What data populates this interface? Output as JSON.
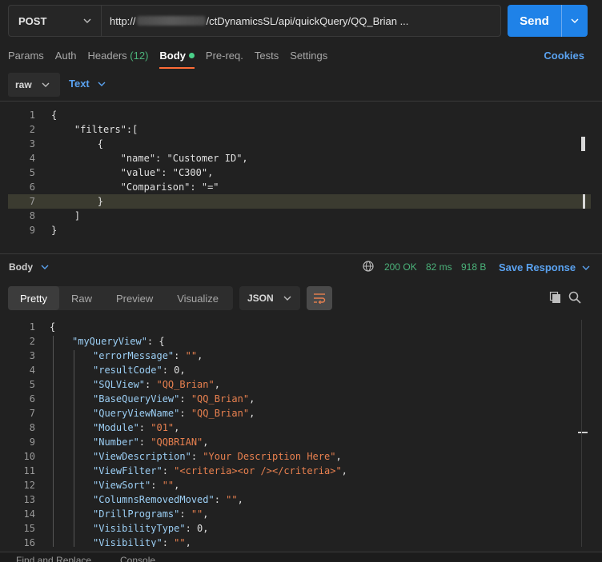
{
  "request": {
    "method": "POST",
    "url_prefix": "http://",
    "url_suffix": "/ctDynamicsSL/api/quickQuery/QQ_Brian ...",
    "send_label": "Send"
  },
  "tabs": [
    {
      "label": "Params"
    },
    {
      "label": "Auth"
    },
    {
      "label": "Headers ",
      "count": "(12)"
    },
    {
      "label": "Body"
    },
    {
      "label": "Pre-req."
    },
    {
      "label": "Tests"
    },
    {
      "label": "Settings"
    }
  ],
  "cookies_label": "Cookies",
  "body_mode": "raw",
  "body_format": "Text",
  "request_body_lines": [
    {
      "n": "1",
      "t": "{"
    },
    {
      "n": "2",
      "t": "    \"filters\":["
    },
    {
      "n": "3",
      "t": "        {"
    },
    {
      "n": "4",
      "t": "            \"name\": \"Customer ID\","
    },
    {
      "n": "5",
      "t": "            \"value\": \"C300\","
    },
    {
      "n": "6",
      "t": "            \"Comparison\": \"=\""
    },
    {
      "n": "7",
      "t": "        }"
    },
    {
      "n": "8",
      "t": "    ]"
    },
    {
      "n": "9",
      "t": "}"
    }
  ],
  "response": {
    "section_label": "Body",
    "status": "200 OK",
    "time": "82 ms",
    "size": "918 B",
    "save_label": "Save Response",
    "view_tabs": [
      "Pretty",
      "Raw",
      "Preview",
      "Visualize"
    ],
    "format": "JSON"
  },
  "response_lines": [
    {
      "n": "1"
    },
    {
      "n": "2"
    },
    {
      "n": "3"
    },
    {
      "n": "4"
    },
    {
      "n": "5"
    },
    {
      "n": "6"
    },
    {
      "n": "7"
    },
    {
      "n": "8"
    },
    {
      "n": "9"
    },
    {
      "n": "10"
    },
    {
      "n": "11"
    },
    {
      "n": "12"
    },
    {
      "n": "13"
    },
    {
      "n": "14"
    },
    {
      "n": "15"
    },
    {
      "n": "16"
    }
  ],
  "response_json": {
    "root_key": "\"myQueryView\"",
    "fields": [
      {
        "k": "\"errorMessage\"",
        "v": "\"\"",
        "type": "s"
      },
      {
        "k": "\"resultCode\"",
        "v": "0",
        "type": "n"
      },
      {
        "k": "\"SQLView\"",
        "v": "\"QQ_Brian\"",
        "type": "s"
      },
      {
        "k": "\"BaseQueryView\"",
        "v": "\"QQ_Brian\"",
        "type": "s"
      },
      {
        "k": "\"QueryViewName\"",
        "v": "\"QQ_Brian\"",
        "type": "s"
      },
      {
        "k": "\"Module\"",
        "v": "\"01\"",
        "type": "s"
      },
      {
        "k": "\"Number\"",
        "v": "\"QQBRIAN\"",
        "type": "s"
      },
      {
        "k": "\"ViewDescription\"",
        "v": "\"Your Description Here\"",
        "type": "s"
      },
      {
        "k": "\"ViewFilter\"",
        "v": "\"<criteria><or /></criteria>\"",
        "type": "s"
      },
      {
        "k": "\"ViewSort\"",
        "v": "\"\"",
        "type": "s"
      },
      {
        "k": "\"ColumnsRemovedMoved\"",
        "v": "\"\"",
        "type": "s"
      },
      {
        "k": "\"DrillPrograms\"",
        "v": "\"\"",
        "type": "s"
      },
      {
        "k": "\"VisibilityType\"",
        "v": "0",
        "type": "n"
      },
      {
        "k": "\"Visibility\"",
        "v": "\"\"",
        "type": "s"
      }
    ]
  },
  "footer": {
    "find_replace": "Find and Replace",
    "console": "Console"
  },
  "colors": {
    "accent": "#1f82e8",
    "tab_underline": "#ff6c37",
    "ok_green": "#4bb37a",
    "json_key": "#9ccff5",
    "json_string": "#e8804f"
  }
}
